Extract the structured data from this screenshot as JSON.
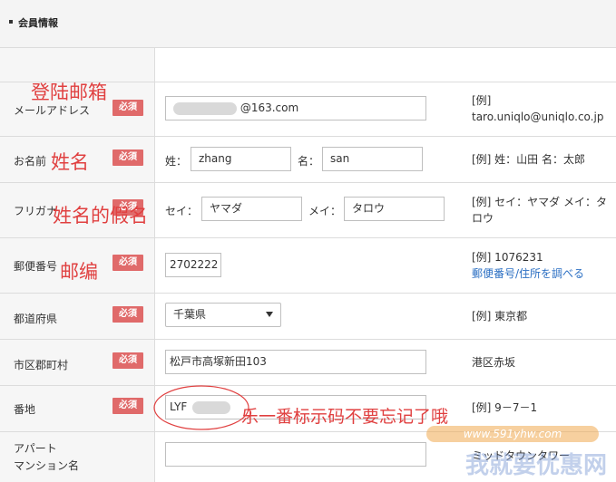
{
  "section": {
    "title": "会員情報"
  },
  "rows": {
    "email": {
      "label": "メールアドレス",
      "required": "必須",
      "value": "@163.com",
      "example": "[例]\ntaro.uniqlo@uniqlo.co.jp"
    },
    "name": {
      "label": "お名前",
      "required": "必須",
      "sei_label": "姓：",
      "sei_value": "zhang",
      "mei_label": "名：",
      "mei_value": "san",
      "example": "[例] 姓：山田 名：太郎"
    },
    "furigana": {
      "label": "フリガナ",
      "required": "必須",
      "sei_label": "セイ：",
      "sei_value": "ヤマダ",
      "mei_label": "メイ：",
      "mei_value": "タロウ",
      "example": "[例] セイ：ヤマダ メイ：タ\nロウ"
    },
    "postal": {
      "label": "郵便番号",
      "required": "必須",
      "value": "2702222",
      "example": "[例] 1076231",
      "link": "郵便番号/住所を調べる"
    },
    "prefecture": {
      "label": "都道府県",
      "required": "必須",
      "value": "千葉県",
      "example": "[例] 東京都"
    },
    "city": {
      "label": "市区郡町村",
      "required": "必須",
      "value": "松戸市高塚新田103",
      "example": "港区赤坂"
    },
    "address": {
      "label": "番地",
      "required": "必須",
      "value": "LYF",
      "example": "[例] 9－7－1"
    },
    "apartment": {
      "label_line1": "アパート",
      "label_line2": "マンション名",
      "value": "",
      "example": "ミッドタウンタワー"
    }
  },
  "annotations": {
    "email": "登陆邮箱",
    "name": "姓名",
    "furigana": "姓名的假名",
    "postal": "邮编",
    "address": "乐一番标示码不要忘记了哦",
    "color": "#e04040"
  },
  "watermark": {
    "url": "www.591yhw.com",
    "text": "我就要优惠网"
  }
}
